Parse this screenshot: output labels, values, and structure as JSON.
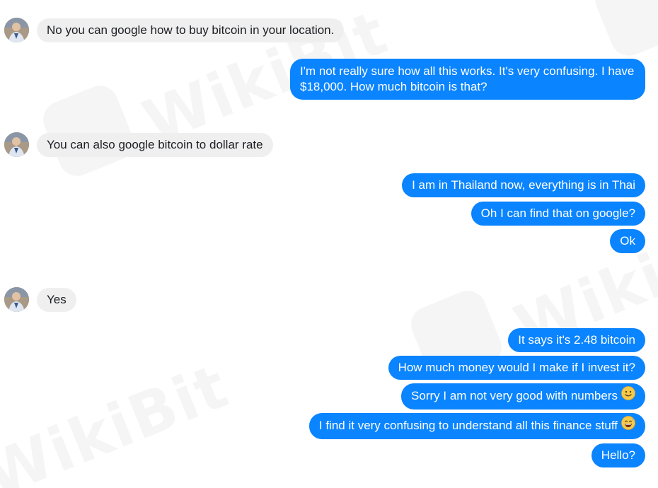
{
  "messages": [
    {
      "direction": "incoming",
      "text": "No you can google how to buy bitcoin in your location."
    },
    {
      "direction": "outgoing",
      "text": "I'm not really sure how all this works. It's very confusing. I have $18,000. How much bitcoin is that?"
    },
    {
      "direction": "incoming",
      "text": "You can also google bitcoin to dollar rate"
    },
    {
      "direction": "outgoing",
      "text": "I am in Thailand now, everything is in Thai"
    },
    {
      "direction": "outgoing",
      "text": "Oh I can find that on google?"
    },
    {
      "direction": "outgoing",
      "text": "Ok"
    },
    {
      "direction": "incoming",
      "text": "Yes"
    },
    {
      "direction": "outgoing",
      "text": "It says it's 2.48 bitcoin"
    },
    {
      "direction": "outgoing",
      "text": "How much money would I make if I invest it?"
    },
    {
      "direction": "outgoing",
      "text": "Sorry I am not very good with numbers",
      "emoji": "slightly-smiling-face-icon"
    },
    {
      "direction": "outgoing",
      "text": "I find it very confusing to understand all this finance stuff",
      "emoji": "grinning-sweat-face-icon"
    },
    {
      "direction": "outgoing",
      "text": "Hello?"
    }
  ],
  "watermark": "WikiBit",
  "colors": {
    "outgoing_bubble": "#0a84ff",
    "incoming_bubble": "#efeff0",
    "incoming_text": "#1c1e21",
    "outgoing_text": "#ffffff"
  }
}
